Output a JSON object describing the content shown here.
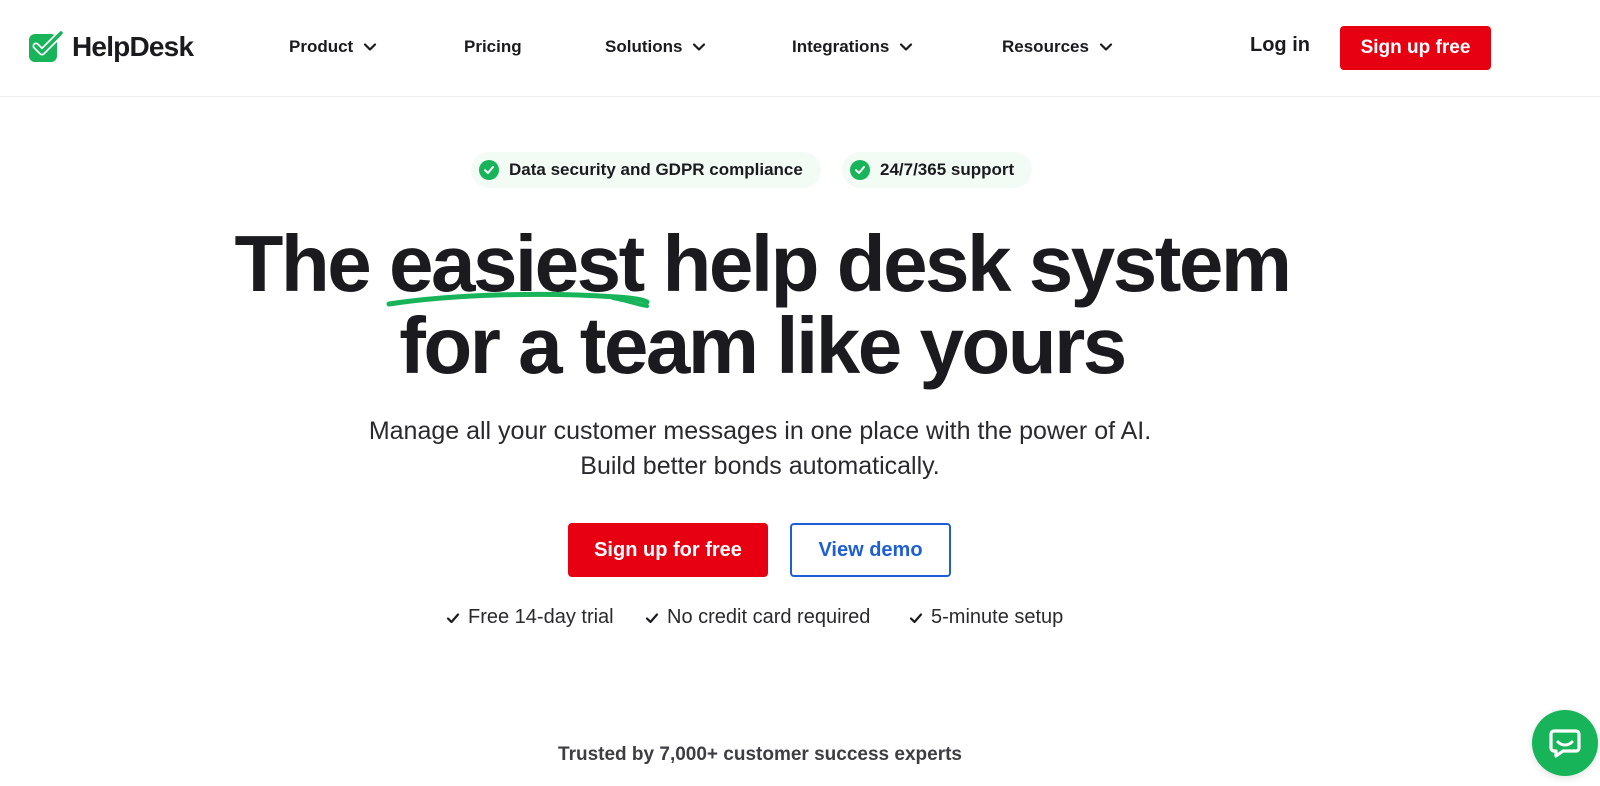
{
  "brand": {
    "name": "HelpDesk",
    "accent": "#17b45a",
    "cta_red": "#e60012",
    "link_blue": "#1e5fd6"
  },
  "nav": {
    "items": [
      {
        "label": "Product",
        "dropdown": true
      },
      {
        "label": "Pricing",
        "dropdown": false
      },
      {
        "label": "Solutions",
        "dropdown": true
      },
      {
        "label": "Integrations",
        "dropdown": true
      },
      {
        "label": "Resources",
        "dropdown": true
      }
    ],
    "login": "Log in",
    "signup": "Sign up free"
  },
  "badges": [
    {
      "icon": "check-circle-icon",
      "label": "Data security and GDPR compliance"
    },
    {
      "icon": "check-circle-icon",
      "label": "24/7/365 support"
    }
  ],
  "hero": {
    "line1_pre": "The",
    "line1_emphasis": "easiest",
    "line1_post": "help desk system",
    "line2": "for a team like yours",
    "subtitle_1": "Manage all your customer messages in one place with the power of AI.",
    "subtitle_2": "Build better bonds automatically.",
    "cta_primary": "Sign up for free",
    "cta_secondary": "View demo",
    "perks": [
      "Free 14-day trial",
      "No credit card required",
      "5-minute setup"
    ]
  },
  "trusted": "Trusted by 7,000+ customer success experts",
  "chat_widget": {
    "icon": "chat-bubble-icon"
  }
}
